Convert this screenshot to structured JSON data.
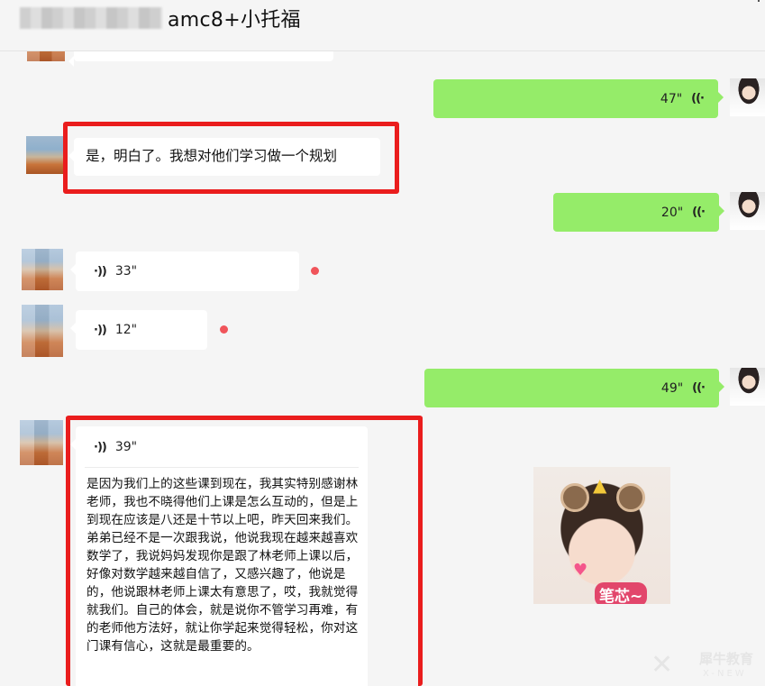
{
  "header": {
    "title_suffix": "amc8+小托福"
  },
  "messages": {
    "voice_right_1": {
      "duration": "47\""
    },
    "text_left_1": {
      "text": "是，明白了。我想对他们学习做一个规划"
    },
    "voice_right_2": {
      "duration": "20\""
    },
    "voice_left_1": {
      "duration": "33\""
    },
    "voice_left_2": {
      "duration": "12\""
    },
    "voice_right_3": {
      "duration": "49\""
    },
    "voice_left_3": {
      "duration": "39\"",
      "transcript": "是因为我们上的这些课到现在，我其实特别感谢林老师，我也不晓得他们上课是怎么互动的，但是上到现在应该是八还是十节以上吧，昨天回来我们。弟弟已经不是一次跟我说，他说我现在越来越喜欢数学了，我说妈妈发现你是跟了林老师上课以后，好像对数学越来越自信了，又感兴趣了，他说是的，他说跟林老师上课太有意思了，哎，我就觉得就我们。自己的体会，就是说你不管学习再难，有的老师他方法好，就让你学起来觉得轻松，你对这门课有信心，这就是最重要的。"
    },
    "sticker": {
      "caption": "笔芯~"
    }
  },
  "watermark": {
    "brand": "犀牛教育",
    "sub": "X-NEW"
  },
  "icons": {
    "voice": "voice-wave-icon"
  },
  "colors": {
    "green_bubble": "#95ec69",
    "highlight": "#ea1d1d",
    "unread": "#f0545a"
  }
}
